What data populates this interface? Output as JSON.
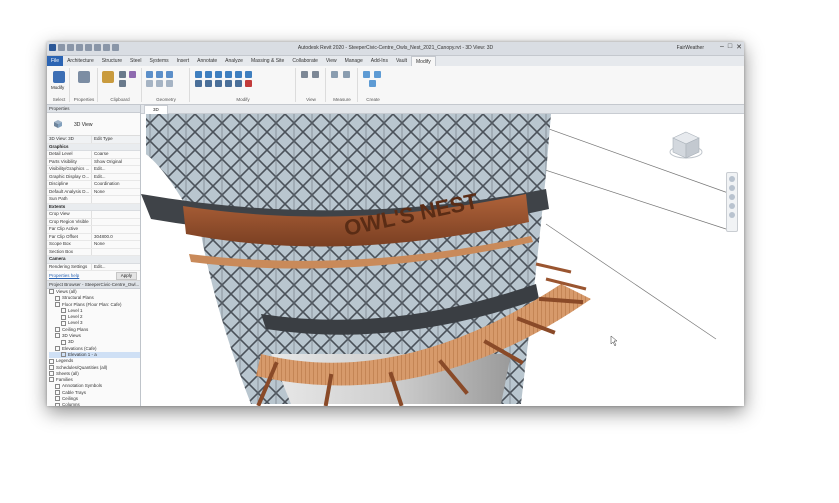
{
  "app": {
    "title": "Autodesk Revit 2020 - SteeperCivic-Centre_Owls_Nest_2021_Canopy.rvt - 3D View: 3D",
    "user": "FairWeather",
    "window_buttons": [
      "–",
      "□",
      "✕"
    ]
  },
  "ribbon": {
    "tabs": [
      "File",
      "Architecture",
      "Structure",
      "Steel",
      "Systems",
      "Insert",
      "Annotate",
      "Analyze",
      "Massing & Site",
      "Collaborate",
      "View",
      "Manage",
      "Add-Ins",
      "Vault",
      "Modify"
    ],
    "active_tab": "Modify",
    "groups": [
      "Select",
      "Properties",
      "Clipboard",
      "Geometry",
      "Modify",
      "View",
      "Measure",
      "Create"
    ],
    "modify_button": "Modify",
    "clipboard": {
      "paste": "Paste",
      "cut": "Cut",
      "join": "Join"
    }
  },
  "properties": {
    "header": "Properties",
    "type_name": "3D View",
    "instance_selector": "3D View: 3D",
    "edit_type": "Edit Type",
    "sections": [
      {
        "name": "Graphics",
        "rows": [
          {
            "k": "Detail Level",
            "v": "Coarse"
          },
          {
            "k": "Parts Visibility",
            "v": "Show Original"
          },
          {
            "k": "Visibility/Graphics ...",
            "v": "Edit..."
          },
          {
            "k": "Graphic Display O...",
            "v": "Edit..."
          },
          {
            "k": "Discipline",
            "v": "Coordination"
          },
          {
            "k": "Default Analysis D...",
            "v": "None"
          },
          {
            "k": "Sun Path",
            "v": ""
          }
        ]
      },
      {
        "name": "Extents",
        "rows": [
          {
            "k": "Crop View",
            "v": ""
          },
          {
            "k": "Crop Region Visible",
            "v": ""
          },
          {
            "k": "Far Clip Active",
            "v": ""
          },
          {
            "k": "Far Clip Offset",
            "v": "304800.0"
          },
          {
            "k": "Scope Box",
            "v": "None"
          },
          {
            "k": "Section Box",
            "v": ""
          }
        ]
      },
      {
        "name": "Camera",
        "rows": [
          {
            "k": "Rendering Settings",
            "v": "Edit..."
          }
        ]
      }
    ],
    "help_link": "Properties help",
    "apply": "Apply"
  },
  "project_browser": {
    "header": "Project Browser - SteeperCivic-Centre_Owl...",
    "nodes": [
      {
        "label": "Views (all)",
        "depth": 0
      },
      {
        "label": "Structural Plans",
        "depth": 1
      },
      {
        "label": "Floor Plans (Floor Plan: Cafe)",
        "depth": 1
      },
      {
        "label": "Level 1",
        "depth": 2
      },
      {
        "label": "Level 2",
        "depth": 2
      },
      {
        "label": "Level 3",
        "depth": 2
      },
      {
        "label": "Ceiling Plans",
        "depth": 1
      },
      {
        "label": "3D Views",
        "depth": 1
      },
      {
        "label": "3D",
        "depth": 2
      },
      {
        "label": "Elevations (Cafe)",
        "depth": 1
      },
      {
        "label": "Elevation 1 - a",
        "depth": 2
      },
      {
        "label": "Legends",
        "depth": 0
      },
      {
        "label": "Schedules/Quantities (all)",
        "depth": 0
      },
      {
        "label": "Sheets (all)",
        "depth": 0
      },
      {
        "label": "Families",
        "depth": 0
      },
      {
        "label": "Annotation Symbols",
        "depth": 1
      },
      {
        "label": "Cable Trays",
        "depth": 1
      },
      {
        "label": "Ceilings",
        "depth": 1
      },
      {
        "label": "Columns",
        "depth": 1
      },
      {
        "label": "Conduits",
        "depth": 1
      },
      {
        "label": "Curtain Panels",
        "depth": 1
      }
    ]
  },
  "view": {
    "tab_label": "3D",
    "sign_text": "OWL'S NEST"
  },
  "colors": {
    "accent": "#2b64b3",
    "wood": "#9c5a35",
    "steel": "#5b6068"
  }
}
